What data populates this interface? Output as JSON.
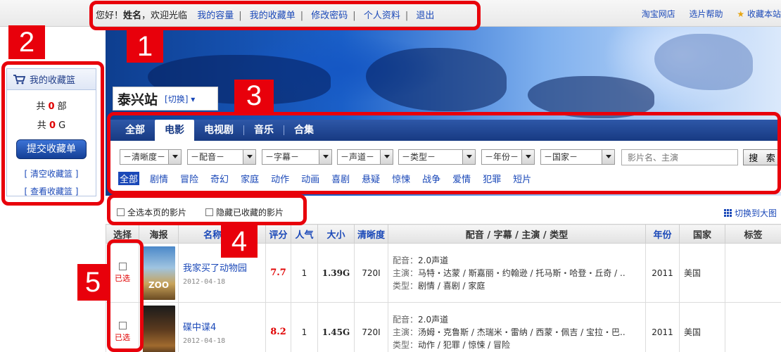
{
  "topbar": {
    "greeting": "您好！",
    "user_name": "姓名",
    "welcome": "，欢迎光临",
    "links": [
      "我的容量",
      "我的收藏单",
      "修改密码",
      "个人资料",
      "退出"
    ],
    "right_links": [
      "淘宝网店",
      "选片帮助",
      "收藏本站"
    ]
  },
  "basket": {
    "title": "我的收藏篮",
    "count_prefix": "共",
    "movie_count": "0",
    "movie_unit": "部",
    "size_count": "0",
    "size_unit": "G",
    "submit_label": "提交收藏单",
    "clear_link": "[ 清空收藏篮 ]",
    "view_link": "[ 查看收藏篮 ]"
  },
  "station": {
    "name": "泰兴站",
    "switch_label": "[切换]"
  },
  "nav": {
    "tabs": [
      "全部",
      "电影",
      "电视剧",
      "音乐",
      "合集"
    ],
    "active": "电影"
  },
  "filters": {
    "selects": [
      "－清晰度－",
      "－配音－",
      "－字幕－",
      "－声道－",
      "－类型－",
      "－年份－",
      "－国家－"
    ],
    "search_placeholder": "影片名、主演",
    "search_button": "搜 索",
    "genres": [
      "全部",
      "剧情",
      "冒险",
      "奇幻",
      "家庭",
      "动作",
      "动画",
      "喜剧",
      "悬疑",
      "惊悚",
      "战争",
      "爱情",
      "犯罪",
      "短片"
    ]
  },
  "options": {
    "select_page": "全选本页的影片",
    "hide_collected": "隐藏已收藏的影片",
    "switch_view": "切换到大图"
  },
  "table": {
    "headers": [
      "选择",
      "海报",
      "名称 / 更",
      "评分",
      "人气",
      "大小",
      "清晰度",
      "配音 / 字幕 / 主演 / 类型",
      "年份",
      "国家",
      "标签"
    ],
    "picked_label": "已选",
    "rows": [
      {
        "poster_text": "ZOO",
        "title": "我家买了动物园",
        "date": "2012-04-18",
        "score": "7.7",
        "popularity": "1",
        "size": "1.39G",
        "quality": "720I",
        "dub_label": "配音：",
        "dub": "2.0声道",
        "cast_label": "主演：",
        "cast": "马特・达蒙 / 斯嘉丽・约翰逊 / 托马斯・哈登・丘奇 / ..",
        "genre_label": "类型：",
        "genre": "剧情 / 喜剧 / 家庭",
        "year": "2011",
        "country": "美国"
      },
      {
        "poster_text": "",
        "title": "碟中谍4",
        "date": "2012-04-18",
        "score": "8.2",
        "popularity": "1",
        "size": "1.45G",
        "quality": "720I",
        "dub_label": "配音：",
        "dub": "2.0声道",
        "cast_label": "主演：",
        "cast": "汤姆・克鲁斯 / 杰瑞米・雷纳 / 西蒙・佩吉 / 宝拉・巴..",
        "genre_label": "类型：",
        "genre": "动作 / 犯罪 / 惊悚 / 冒险",
        "year": "2011",
        "country": "美国"
      }
    ]
  },
  "annotations": [
    "1",
    "2",
    "3",
    "4",
    "5"
  ]
}
